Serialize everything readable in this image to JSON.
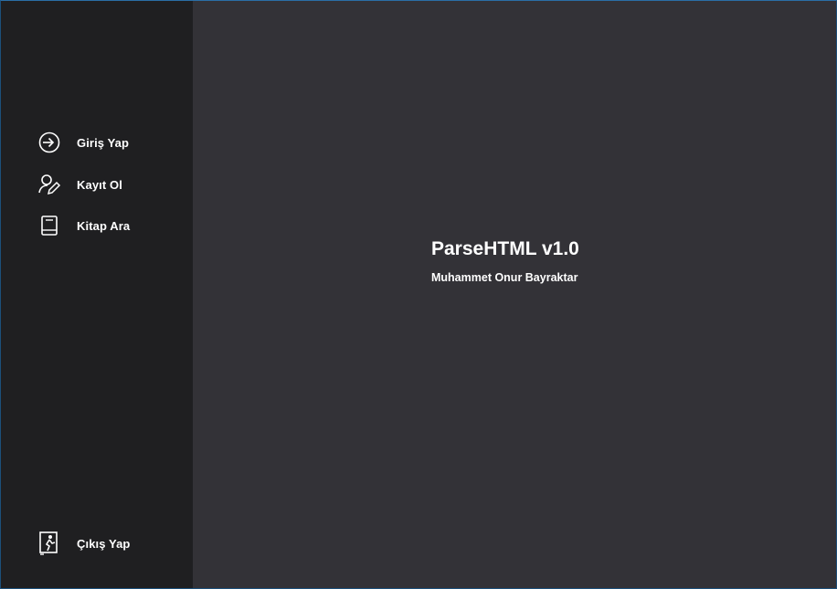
{
  "sidebar": {
    "items": [
      {
        "label": "Giriş Yap",
        "icon": "login-icon"
      },
      {
        "label": "Kayıt Ol",
        "icon": "user-edit-icon"
      },
      {
        "label": "Kitap Ara",
        "icon": "book-icon"
      }
    ],
    "exit": {
      "label": "Çıkış Yap",
      "icon": "exit-door-icon"
    }
  },
  "main": {
    "title": "ParseHTML v1.0",
    "author": "Muhammet Onur Bayraktar"
  },
  "colors": {
    "sidebar_bg": "#1f1f21",
    "main_bg": "#333237",
    "text": "#ffffff",
    "window_border": "#2a6ea6"
  }
}
